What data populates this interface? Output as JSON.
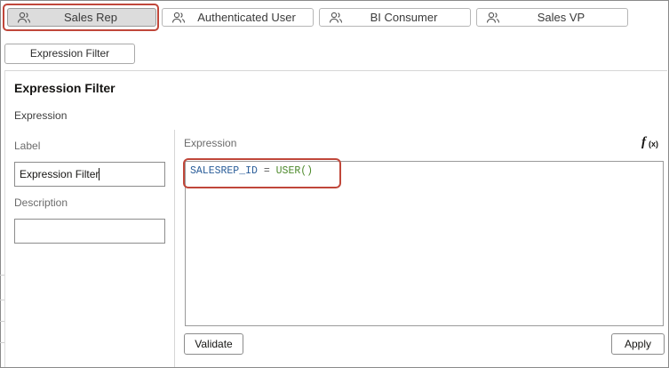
{
  "roles": [
    {
      "label": "Sales Rep",
      "icon": "users-icon",
      "active": true
    },
    {
      "label": "Authenticated User",
      "icon": "users-icon",
      "active": false
    },
    {
      "label": "BI Consumer",
      "icon": "users-icon",
      "active": false
    },
    {
      "label": "Sales VP",
      "icon": "users-icon",
      "active": false
    }
  ],
  "filter_button": "Expression Filter",
  "panel": {
    "title": "Expression Filter",
    "section": "Expression",
    "label_label": "Label",
    "label_value": "Expression Filter",
    "description_label": "Description",
    "description_value": ""
  },
  "expression": {
    "label": "Expression",
    "fx_icon": "function-icon",
    "code": {
      "ident": "SALESREP_ID",
      "op": "=",
      "func": "USER()"
    }
  },
  "buttons": {
    "validate": "Validate",
    "apply": "Apply"
  },
  "colors": {
    "highlight": "#c0473a",
    "active_tab": "#dcdcdc",
    "code_ident": "#2a5d99",
    "code_func": "#4d8a2b"
  }
}
